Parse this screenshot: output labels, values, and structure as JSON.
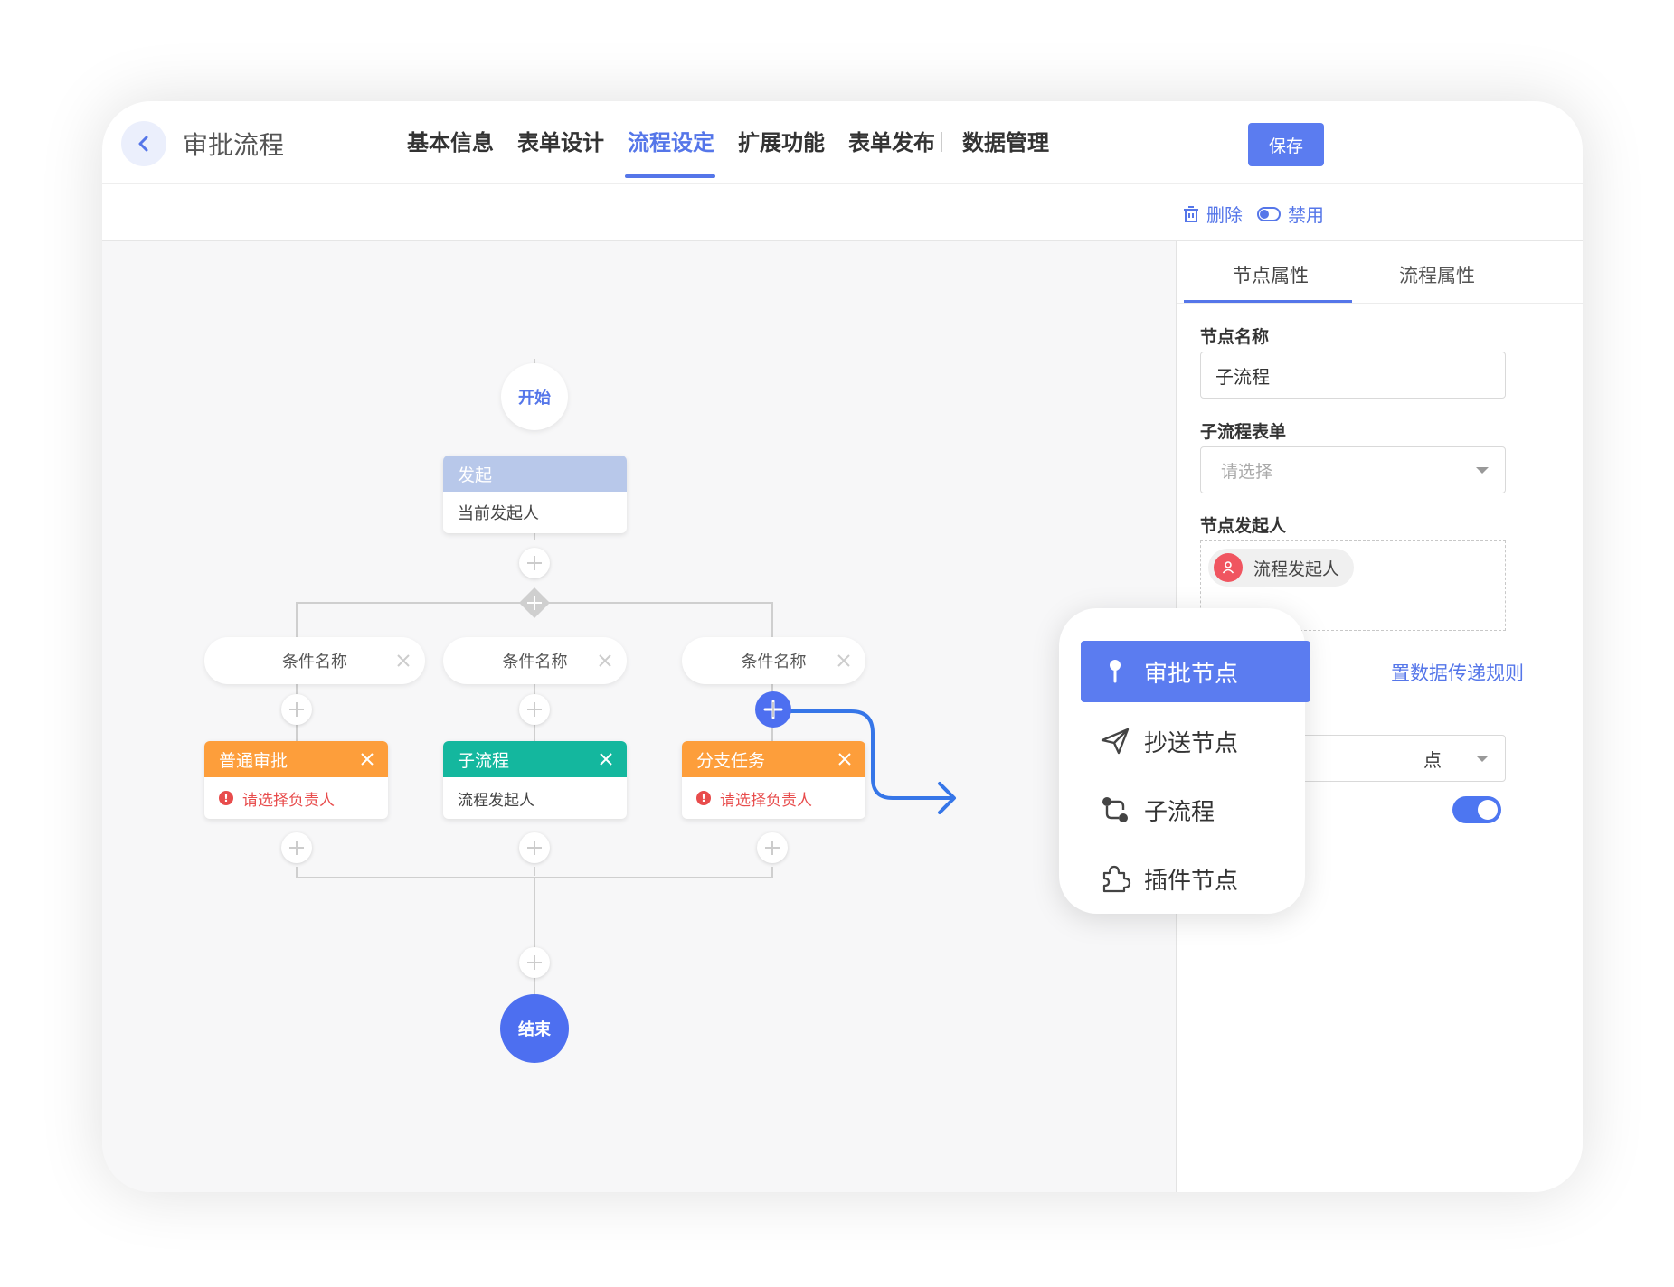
{
  "header": {
    "title": "审批流程",
    "tabs": [
      "基本信息",
      "表单设计",
      "流程设定",
      "扩展功能",
      "表单发布",
      "数据管理"
    ],
    "active_tab": "流程设定",
    "save_label": "保存"
  },
  "toolbar": {
    "delete_label": "删除",
    "disable_label": "禁用"
  },
  "flow": {
    "start_label": "开始",
    "end_label": "结束",
    "initiate_node": {
      "title": "发起",
      "body": "当前发起人"
    },
    "conditions": [
      "条件名称",
      "条件名称",
      "条件名称"
    ],
    "branches": [
      {
        "title": "普通审批",
        "body": "请选择负责人",
        "color": "#fd9e3b",
        "error": true
      },
      {
        "title": "子流程",
        "body": "流程发起人",
        "color": "#14b79e",
        "error": false
      },
      {
        "title": "分支任务",
        "body": "请选择负责人",
        "color": "#fd9e3b",
        "error": true
      }
    ]
  },
  "panel": {
    "tabs": [
      "节点属性",
      "流程属性"
    ],
    "node_name_label": "节点名称",
    "node_name_value": "子流程",
    "subflow_form_label": "子流程表单",
    "subflow_form_placeholder": "请选择",
    "initiator_label": "节点发起人",
    "initiator_chip": "流程发起人",
    "data_rule_link": "置数据传递规则",
    "partial_select_value": "点"
  },
  "popup_menu": {
    "items": [
      "审批节点",
      "抄送节点",
      "子流程",
      "插件节点"
    ],
    "active": "审批节点"
  },
  "colors": {
    "accent": "#5576e9",
    "orange": "#fd9e3b",
    "teal": "#14b79e",
    "initiate_head": "#b8c8ea",
    "error": "#e84c4c"
  }
}
